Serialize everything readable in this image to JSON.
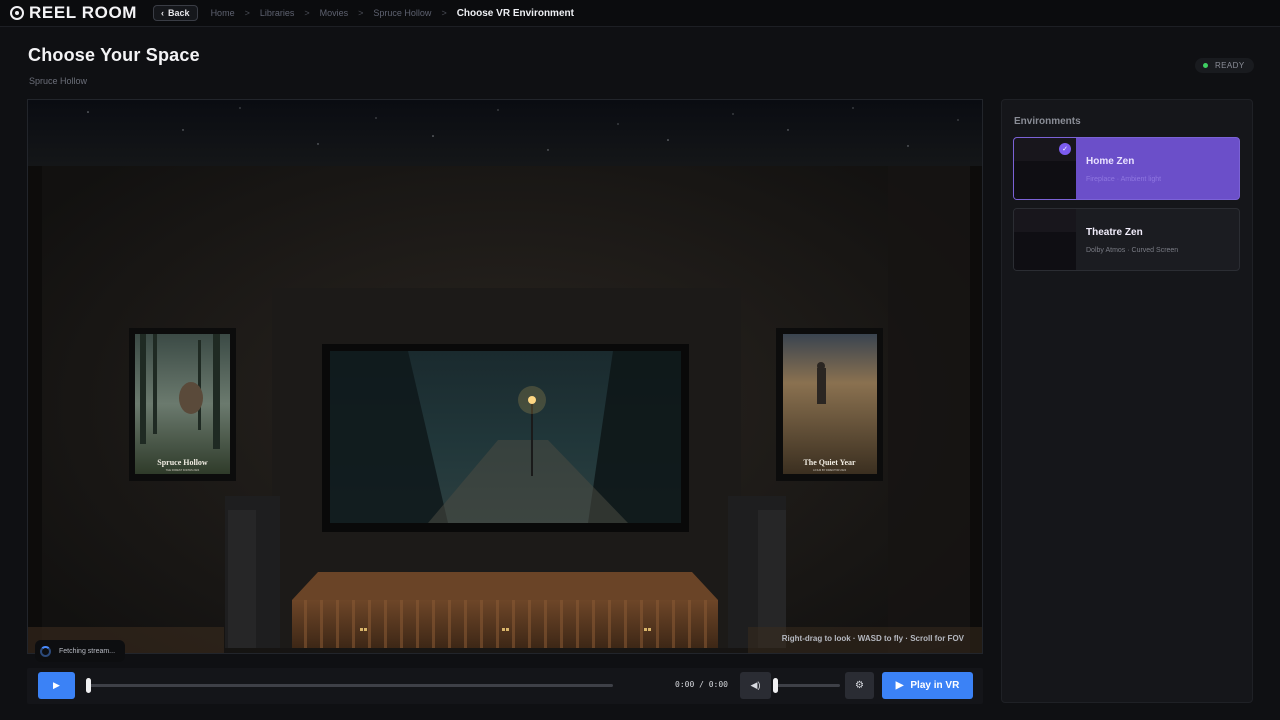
{
  "app": {
    "name": "REEL ROOM"
  },
  "nav": {
    "back_label": "Back",
    "breadcrumbs": [
      "Home",
      "Libraries",
      "Movies",
      "Spruce Hollow"
    ],
    "current": "Choose VR Environment",
    "separator": ">"
  },
  "header": {
    "title": "Choose Your Space",
    "subtitle": "Spruce Hollow",
    "status": "READY"
  },
  "viewport": {
    "hint": "Right-drag to look · WASD to fly · Scroll for FOV",
    "fetch_status": "Fetching stream...",
    "posters": [
      {
        "title": "Spruce Hollow",
        "tagline": "THE FOREST KNOWS  2024"
      },
      {
        "title": "The Quiet Year",
        "tagline": "A FILM BY DIRECTOR  2024"
      }
    ]
  },
  "player": {
    "time": "0:00 / 0:00",
    "play_label": "Play in VR",
    "progress": 0,
    "volume": 0
  },
  "environments": {
    "title": "Environments",
    "items": [
      {
        "name": "Home Zen",
        "desc": "Fireplace · Ambient light",
        "selected": true
      },
      {
        "name": "Theatre Zen",
        "desc": "Dolby Atmos · Curved Screen",
        "selected": false
      }
    ]
  },
  "colors": {
    "accent": "#3b82f6",
    "selected": "#6b4fc9",
    "ready": "#3ecf62"
  }
}
